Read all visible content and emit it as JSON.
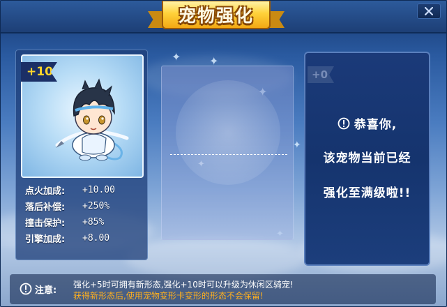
{
  "window": {
    "title": "宠物强化",
    "close_icon": "close-icon"
  },
  "pet": {
    "level_badge": "+10",
    "stats": [
      {
        "label": "点火加成:",
        "value": "+10.00"
      },
      {
        "label": "落后补偿:",
        "value": "+250%"
      },
      {
        "label": "撞击保护:",
        "value": "+85%"
      },
      {
        "label": "引擎加成:",
        "value": "+8.00"
      }
    ]
  },
  "next": {
    "level_badge": "+0",
    "message_line1": "恭喜你,",
    "message_line2": "该宠物当前已经",
    "message_line3": "强化至满级啦!!"
  },
  "footer": {
    "label": "注意:",
    "note1": "强化+5时可拥有新形态,强化+10时可以升级为休闲区骑宠!",
    "note2": "获得新形态后,使用宠物变形卡变形的形态不会保留!"
  },
  "colors": {
    "badge_text": "#ffd52a",
    "note_highlight": "#ffb01e",
    "banner_gold": "#ffd23a"
  }
}
